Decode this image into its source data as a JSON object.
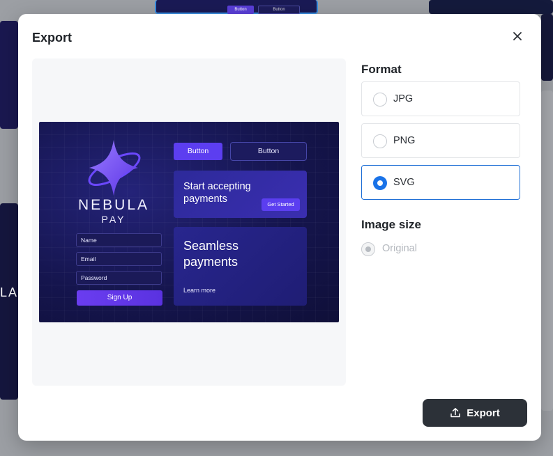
{
  "background": {
    "letters": "LA",
    "btn1": "Button",
    "btn2": "Button"
  },
  "dialog": {
    "title": "Export",
    "close_icon": "close-icon"
  },
  "preview": {
    "brand_line1": "NEBULA",
    "brand_line2": "PAY",
    "fields": [
      "Name",
      "Email",
      "Password"
    ],
    "signup_label": "Sign Up",
    "button_primary": "Button",
    "button_secondary": "Button",
    "card1_title": "Start accepting payments",
    "card1_button": "Get Started",
    "card2_title": "Seamless payments",
    "card2_link": "Learn more"
  },
  "format": {
    "label": "Format",
    "options": [
      {
        "label": "JPG",
        "selected": false
      },
      {
        "label": "PNG",
        "selected": false
      },
      {
        "label": "SVG",
        "selected": true
      }
    ]
  },
  "image_size": {
    "label": "Image size",
    "option": "Original",
    "disabled": true
  },
  "export_button": {
    "label": "Export",
    "icon": "upload-icon"
  },
  "colors": {
    "accent": "#1a73e8",
    "export_bg": "#2c3138",
    "preview_bg": "#15154e"
  }
}
